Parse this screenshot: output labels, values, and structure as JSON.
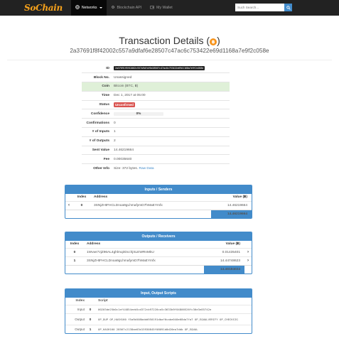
{
  "nav": {
    "logo": "SoChain",
    "items": [
      {
        "label": "Networks",
        "icon": "globe-icon",
        "active": true
      },
      {
        "label": "Blockchain API",
        "icon": "gear-icon",
        "active": false
      },
      {
        "label": "My Wallet",
        "icon": "wallet-icon",
        "active": false
      }
    ],
    "search_placeholder": "Such Search..."
  },
  "page": {
    "title": "Transaction Details (",
    "title_close": ")",
    "coin_symbol": "฿",
    "txid": "2a37691f8f42002c557a9dfaf6e28507c47ac6c753422e69d1168a7e9f2c058e"
  },
  "details": [
    {
      "key": "ID",
      "value": "2a37691f8f42002c557a9dfaf6e28507c47ac6c753422e69d1168a7e9f2c058e",
      "type": "code"
    },
    {
      "key": "Block No.",
      "value": "Unassigned"
    },
    {
      "key": "Coin",
      "value": "Bitcoin (BTC, ฿)",
      "type": "coin"
    },
    {
      "key": "Time",
      "value": "Dec 1, 2017 at 05:00"
    },
    {
      "key": "Status",
      "value": "Unconfirmed",
      "type": "danger"
    },
    {
      "key": "Confidence",
      "value": "0%",
      "type": "progress",
      "fraction": 0.0
    },
    {
      "key": "Confirmations",
      "value": "0"
    },
    {
      "key": "# of Inputs",
      "value": "1"
    },
    {
      "key": "# of Outputs",
      "value": "2"
    },
    {
      "key": "Sent Value",
      "value": "14.46219664"
    },
    {
      "key": "Fee",
      "value": "0.00035640"
    },
    {
      "key": "Other Info",
      "value": "Size: 372 bytes.",
      "link": "Raw Data"
    }
  ],
  "inputs": {
    "title": "Inputs / Senders",
    "headers": {
      "index": "Index",
      "address": "Address",
      "value": "Value (฿)"
    },
    "rows": [
      {
        "index": "0",
        "address": "3SNjZHtFHCLDnoa9gLhmafymD7hMaEYmfx",
        "value": "14.46219664"
      }
    ],
    "total": "14.46219664"
  },
  "outputs": {
    "title": "Outputs / Receivers",
    "headers": {
      "index": "Index",
      "address": "Address",
      "value": "Value (฿)"
    },
    "rows": [
      {
        "index": "0",
        "address": "1Wvwr7zjZ96AL4ghlmq3DcchjSLEWRnMkU",
        "value": "0.01435401"
      },
      {
        "index": "1",
        "address": "3SNjZHtFHCLDnoa9gLhmafymD7hMaEYmfx",
        "value": "14.44748623"
      }
    ],
    "total": "14.46184024"
  },
  "scripts": {
    "title": "Input, Output Scripts",
    "headers": {
      "index": "Index",
      "script": "Script"
    },
    "rows": [
      {
        "io": "Input",
        "index": "0",
        "script": "00203de25b0c1ef44854eeb5cd372cb97220ca5c3633b9f04800526fc36e3e85742e"
      },
      {
        "io": "Output",
        "index": "0",
        "script": "OP_DUP OP_HASH160 f5a9b508bddd950191dbaf6cabe040e68da7fa7 OP_EQUALVERIFY OP_CHECKSIG"
      },
      {
        "io": "Output",
        "index": "1",
        "script": "OP_HASH160 28567c2138ae63d15930845f08091d0d20ea7ddb OP_EQUAL"
      }
    ]
  }
}
